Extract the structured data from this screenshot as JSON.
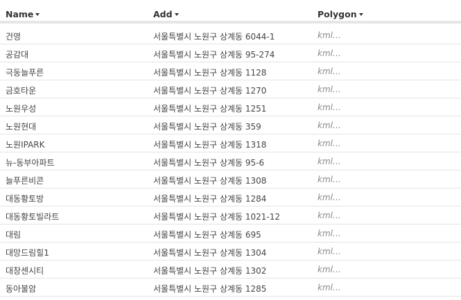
{
  "columns": {
    "name": "Name",
    "add": "Add",
    "polygon": "Polygon"
  },
  "rows": [
    {
      "name": "건영",
      "add": "서울특별시 노원구 상계동 6044-1",
      "polygon": "kml…"
    },
    {
      "name": "공감대",
      "add": "서울특별시 노원구 상계동 95-274",
      "polygon": "kml…"
    },
    {
      "name": "극동늘푸른",
      "add": "서울특별시 노원구 상계동 1128",
      "polygon": "kml…"
    },
    {
      "name": "금호타운",
      "add": "서울특별시 노원구 상계동 1270",
      "polygon": "kml…"
    },
    {
      "name": "노원우성",
      "add": "서울특별시 노원구 상계동 1251",
      "polygon": "kml…"
    },
    {
      "name": "노원현대",
      "add": "서울특별시 노원구 상계동 359",
      "polygon": "kml…"
    },
    {
      "name": "노원IPARK",
      "add": "서울특별시 노원구 상계동 1318",
      "polygon": "kml…"
    },
    {
      "name": "뉴-동부아파트",
      "add": "서울특별시 노원구 상계동 95-6",
      "polygon": "kml…"
    },
    {
      "name": "늘푸른비콘",
      "add": "서울특별시 노원구 상계동 1308",
      "polygon": "kml…"
    },
    {
      "name": "대동황토방",
      "add": "서울특별시 노원구 상계동 1284",
      "polygon": "kml…"
    },
    {
      "name": "대동황토빌라트",
      "add": "서울특별시 노원구 상계동 1021-12",
      "polygon": "kml…"
    },
    {
      "name": "대림",
      "add": "서울특별시 노원구 상계동 695",
      "polygon": "kml…"
    },
    {
      "name": "대망드림힐1",
      "add": "서울특별시 노원구 상계동 1304",
      "polygon": "kml…"
    },
    {
      "name": "대창센시티",
      "add": "서울특별시 노원구 상계동 1302",
      "polygon": "kml…"
    },
    {
      "name": "동아불암",
      "add": "서울특별시 노원구 상계동 1285",
      "polygon": "kml…"
    }
  ]
}
